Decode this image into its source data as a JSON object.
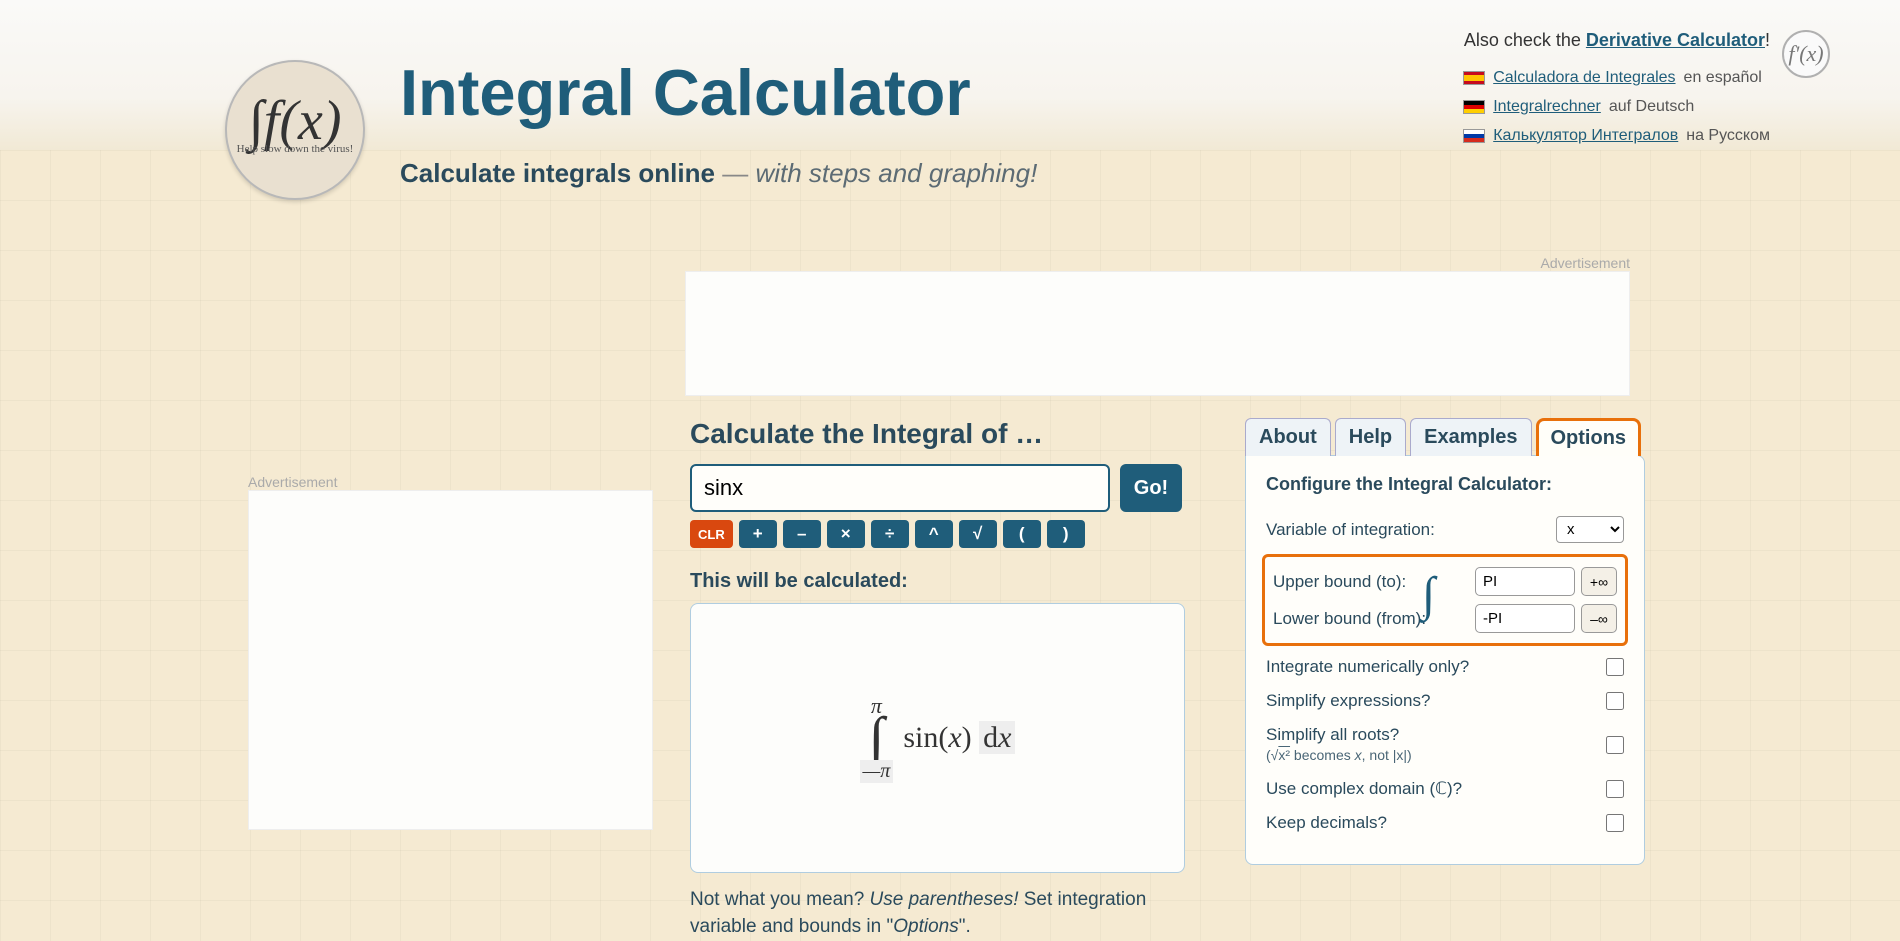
{
  "header": {
    "title": "Integral Calculator",
    "subtitle_lead": "Calculate integrals online",
    "subtitle_dash": " — ",
    "subtitle_em": "with steps and graphing!",
    "also_check_pre": "Also check the ",
    "also_check_link": "Derivative Calculator",
    "also_check_post": "!",
    "logo_badge": "Help slow down the virus!",
    "fx_badge": "f'(x)"
  },
  "langs": {
    "es_link": "Calculadora de Integrales",
    "es_suf": " en español",
    "de_link": "Integralrechner",
    "de_suf": " auf Deutsch",
    "ru_link": "Калькулятор Интегралов",
    "ru_suf": " на Русском"
  },
  "ads": {
    "label": "Advertisement"
  },
  "calc": {
    "heading": "Calculate the Integral of …",
    "expression": "sinx",
    "go": "Go!",
    "keys": {
      "clr": "CLR",
      "plus": "+",
      "minus": "–",
      "times": "×",
      "div": "÷",
      "pow": "^",
      "sqrt": "√",
      "lpar": "(",
      "rpar": ")"
    },
    "preview_heading": "This will be calculated:",
    "preview": {
      "upper": "π",
      "lower": "—π",
      "body_fn": "sin(",
      "body_var": "x",
      "body_close": ") ",
      "dx_d": "d",
      "dx_x": "x"
    },
    "hint_pre": "Not what you mean? ",
    "hint_em": "Use parentheses!",
    "hint_post": " Set integration variable and bounds in \"",
    "hint_opts": "Options",
    "hint_end": "\"."
  },
  "tabs": {
    "about": "About",
    "help": "Help",
    "examples": "Examples",
    "options": "Options"
  },
  "options": {
    "heading": "Configure the Integral Calculator:",
    "var_label": "Variable of integration:",
    "var_value": "x",
    "upper_label": "Upper bound (to):",
    "upper_value": "PI",
    "upper_inf": "+∞",
    "lower_label": "Lower bound (from):",
    "lower_value": "-PI",
    "lower_inf": "–∞",
    "numeric_label": "Integrate numerically only?",
    "simplify_label": "Simplify expressions?",
    "roots_label": "Simplify all roots?",
    "roots_sub_pre": "(√",
    "roots_sub_x2": "x²",
    "roots_sub_mid": " becomes ",
    "roots_sub_x": "x",
    "roots_sub_post": ", not |x|)",
    "complex_label": "Use complex domain (ℂ)?",
    "decimals_label": "Keep decimals?"
  }
}
